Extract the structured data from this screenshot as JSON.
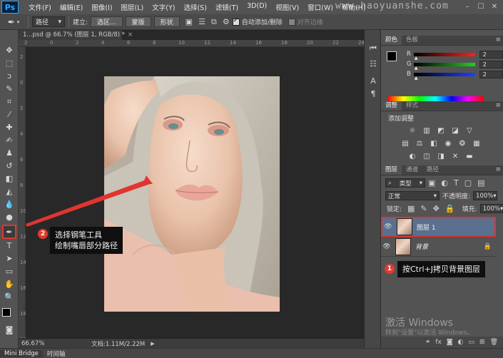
{
  "app": {
    "logo": "Ps",
    "watermark": "www.haoyuanshe.com"
  },
  "menu": [
    "文件(F)",
    "编辑(E)",
    "图像(I)",
    "图层(L)",
    "文字(Y)",
    "选择(S)",
    "滤镜(T)",
    "3D(D)",
    "视图(V)",
    "窗口(W)",
    "帮助(H)"
  ],
  "window_controls": {
    "minimize": "–",
    "maximize": "☐",
    "close": "✕"
  },
  "options": {
    "mode_value": "路径",
    "build_label": "建立:",
    "selection_button": "选区...",
    "mask_button": "蒙版",
    "shape_button": "形状",
    "auto_add_delete": "自动添加/删除",
    "auto_add_delete_checked": true,
    "align_edges": "对齐边缘"
  },
  "document": {
    "tab_title": "1...psd @ 66.7% (图层 1, RGB/8) *",
    "zoom": "66.67%",
    "doc_info": "文档:1.11M/2.22M"
  },
  "ruler": {
    "h_ticks": [
      "2",
      "0",
      "2",
      "4",
      "6",
      "8",
      "10",
      "12",
      "14",
      "16",
      "18",
      "20",
      "22",
      "24"
    ],
    "v_ticks": [
      "2",
      "0",
      "2",
      "4",
      "6",
      "8",
      "10",
      "12",
      "14",
      "16",
      "18",
      "20"
    ]
  },
  "bottom_tabs": [
    "Mini Bridge",
    "时间轴"
  ],
  "color_panel": {
    "tabs": [
      "颜色",
      "色板"
    ],
    "channels": [
      {
        "key": "R",
        "value": "2",
        "gradient": "#ff2020"
      },
      {
        "key": "G",
        "value": "2",
        "gradient": "#20d020"
      },
      {
        "key": "B",
        "value": "2",
        "gradient": "#2040ff"
      }
    ]
  },
  "adjustments_panel": {
    "tabs": [
      "调整",
      "样式"
    ],
    "title": "添加调整",
    "row1_icons": [
      "brightness-icon",
      "levels-icon",
      "curves-icon",
      "exposure-icon",
      "vibrance-icon"
    ],
    "row2_icons": [
      "hue-saturation-icon",
      "color-balance-icon",
      "black-white-icon",
      "photo-filter-icon",
      "channel-mixer-icon",
      "color-lookup-icon"
    ],
    "row3_icons": [
      "invert-icon",
      "posterize-icon",
      "threshold-icon",
      "selective-color-icon",
      "gradient-map-icon"
    ]
  },
  "layers_panel": {
    "tabs": [
      "图层",
      "通道",
      "路径"
    ],
    "filter_label": "类型",
    "blend_mode": "正常",
    "opacity_label": "不透明度:",
    "opacity_value": "100%",
    "lock_label": "锁定:",
    "fill_label": "填充:",
    "fill_value": "100%",
    "layers": [
      {
        "name": "图层 1",
        "selected": true
      },
      {
        "name": "背景",
        "selected": false
      }
    ]
  },
  "annotations": {
    "step1": {
      "badge": "1",
      "text": "按Ctrl+J拷贝背景图层"
    },
    "step2": {
      "badge": "2",
      "line1": "选择钢笔工具",
      "line2": "绘制嘴唇部分路径"
    }
  },
  "activation": {
    "line1": "激活 Windows",
    "line2": "转到\"设置\"以激活 Windows。"
  },
  "colors": {
    "annotation_red": "#e0352f",
    "selected_layer": "#5b6f8f"
  }
}
